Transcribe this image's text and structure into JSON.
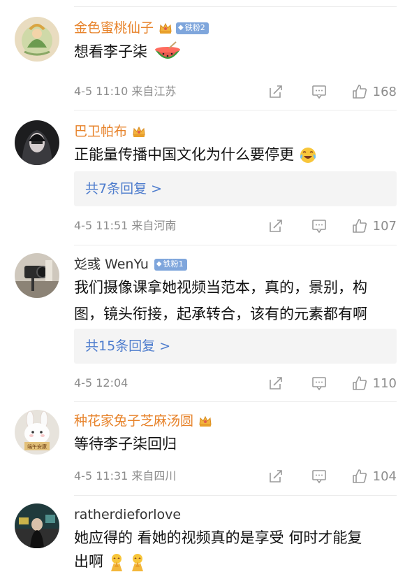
{
  "comments": [
    {
      "username": "金色蜜桃仙子",
      "fan_badge": "铁粉2",
      "text": "想看李子柒",
      "timestamp": "4-5 11:10 来自江苏",
      "likes": "168"
    },
    {
      "username": "巴卫帕布",
      "text": "正能量传播中国文化为什么要停更",
      "replies": "共7条回复 >",
      "timestamp": "4-5 11:51 来自河南",
      "likes": "107"
    },
    {
      "username": "彣彧 WenYu",
      "fan_badge": "铁粉1",
      "text_line1": "我们摄像课拿她视频当范本，真的，景别，构",
      "text_line2": "图，镜头衔接，起承转合，该有的元素都有啊",
      "replies": "共15条回复 >",
      "timestamp": "4-5 12:04",
      "likes": "110"
    },
    {
      "username": "种花家兔子芝麻汤圆",
      "avatar_text": "端午安康",
      "text": "等待李子柒回归",
      "timestamp": "4-5 11:31 来自四川",
      "likes": "104"
    },
    {
      "username": "ratherdieforlove",
      "text_line1": "她应得的 看她的视频真的是享受 何时才能复",
      "text_line2": "出啊"
    }
  ],
  "colors": {
    "vip_name": "#e7832b",
    "reply_link": "#4d7ccd",
    "meta_gray": "#8c8c8c",
    "fan_badge_bg": "#7fa6dc"
  }
}
